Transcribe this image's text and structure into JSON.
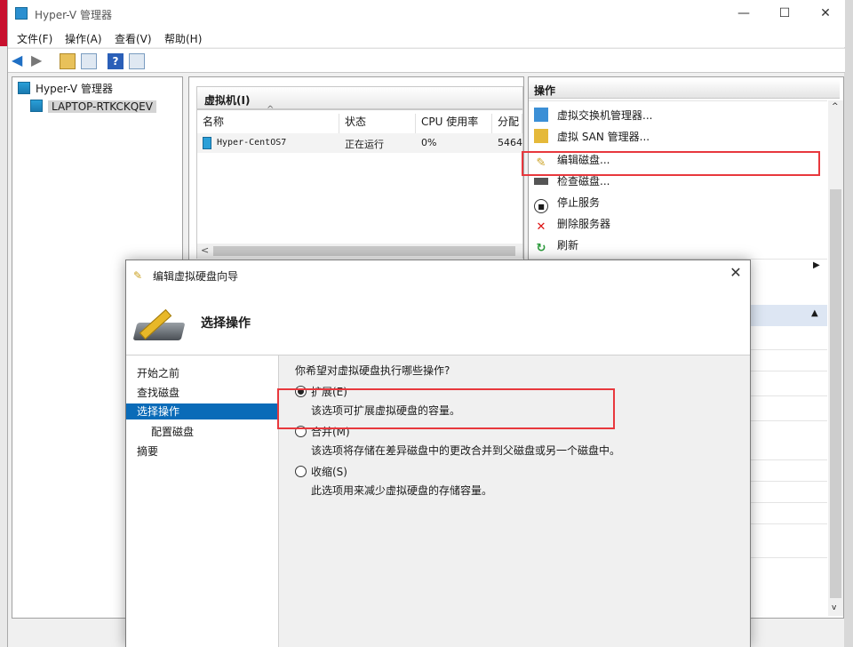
{
  "window": {
    "title": "Hyper-V 管理器",
    "controls": {
      "minimize": "—",
      "maximize": "☐",
      "close": "✕"
    }
  },
  "menu": {
    "file": "文件(F)",
    "action": "操作(A)",
    "view": "查看(V)",
    "help": "帮助(H)"
  },
  "tree": {
    "root": "Hyper-V 管理器",
    "server": "LAPTOP-RTKCKQEV"
  },
  "vm_section": {
    "title": "虚拟机(I)",
    "columns": [
      "名称",
      "状态",
      "CPU 使用率",
      "分配"
    ],
    "rows": [
      {
        "name": "Hyper-CentOS7",
        "state": "正在运行",
        "cpu": "0%",
        "mem": "5464"
      }
    ]
  },
  "actions": {
    "header": "操作",
    "items": [
      {
        "label": "虚拟交换机管理器...",
        "icon": "switch-icon"
      },
      {
        "label": "虚拟 SAN 管理器...",
        "icon": "san-icon"
      },
      {
        "label": "编辑磁盘...",
        "icon": "edit-disk-icon"
      },
      {
        "label": "检查磁盘...",
        "icon": "inspect-disk-icon"
      },
      {
        "label": "停止服务",
        "icon": "stop-icon"
      },
      {
        "label": "删除服务器",
        "icon": "delete-icon"
      },
      {
        "label": "刷新",
        "icon": "refresh-icon"
      }
    ]
  },
  "dialog": {
    "title": "编辑虚拟硬盘向导",
    "heading": "选择操作",
    "nav": [
      "开始之前",
      "查找磁盘",
      "选择操作",
      "配置磁盘",
      "摘要"
    ],
    "selected_nav": "选择操作",
    "question": "你希望对虚拟硬盘执行哪些操作?",
    "options": [
      {
        "label": "扩展(E)",
        "desc": "该选项可扩展虚拟硬盘的容量。",
        "selected": true
      },
      {
        "label": "合并(M)",
        "desc": "该选项将存储在差异磁盘中的更改合并到父磁盘或另一个磁盘中。",
        "selected": false
      },
      {
        "label": "收缩(S)",
        "desc": "此选项用来减少虚拟硬盘的存储容量。",
        "selected": false
      }
    ]
  },
  "colors": {
    "highlight_red": "#e8383d",
    "selection_blue": "#0a6bb8"
  }
}
